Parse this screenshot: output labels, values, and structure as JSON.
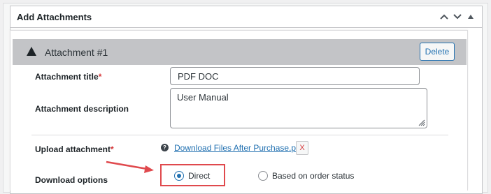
{
  "panel": {
    "title": "Add Attachments"
  },
  "attachment": {
    "heading": "Attachment #1",
    "delete_label": "Delete",
    "title_label": "Attachment title",
    "title_value": "PDF DOC",
    "description_label": "Attachment description",
    "description_value": "User Manual",
    "upload_label": "Upload attachment",
    "required_mark": "*",
    "file_name": "Download Files After Purchase.pdf",
    "remove_label": "X",
    "help_glyph": "?",
    "download_label": "Download options",
    "options": [
      {
        "label": "Direct",
        "selected": true
      },
      {
        "label": "Based on order status",
        "selected": false
      }
    ]
  },
  "icons": {
    "move_up": "chevron-up-icon",
    "move_down": "chevron-down-icon",
    "toggle": "triangle-up-icon",
    "collapse": "triangle-up-icon",
    "help": "question-circle-icon",
    "annotation": "red-arrow-icon"
  },
  "colors": {
    "accent": "#2271b1",
    "danger": "#d63638",
    "highlight": "#e0494d",
    "attachment_header_bg": "#c3c4c7"
  }
}
